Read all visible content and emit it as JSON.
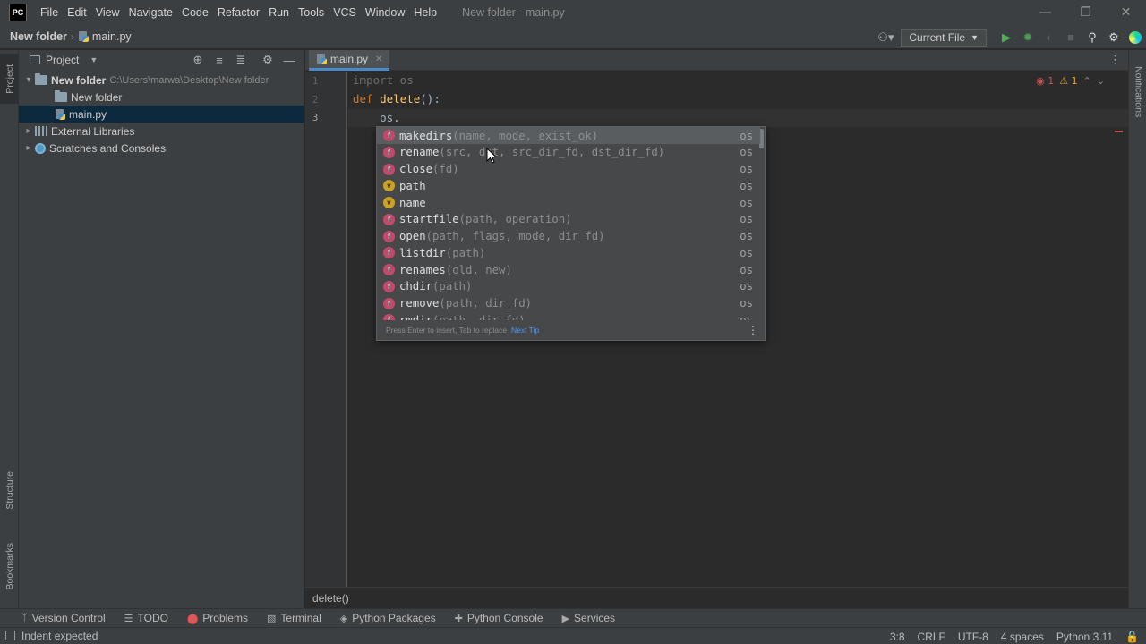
{
  "titlebar": {
    "logo": "PC",
    "menu": [
      "File",
      "Edit",
      "View",
      "Navigate",
      "Code",
      "Refactor",
      "Run",
      "Tools",
      "VCS",
      "Window",
      "Help"
    ],
    "window_title": "New folder - main.py"
  },
  "navbar": {
    "project": "New folder",
    "file": "main.py",
    "run_config": "Current File",
    "colors": {
      "run": "#4caf50",
      "debug": "#499c54"
    }
  },
  "left_stripe": {
    "project": "Project",
    "structure": "Structure",
    "bookmarks": "Bookmarks"
  },
  "project_panel": {
    "title": "Project",
    "tree": {
      "root": "New folder",
      "root_path": "C:\\Users\\marwa\\Desktop\\New folder",
      "child_folder": "New folder",
      "child_file": "main.py",
      "external": "External Libraries",
      "scratches": "Scratches and Consoles"
    }
  },
  "editor": {
    "tab": "main.py",
    "line_numbers": [
      "1",
      "2",
      "3"
    ],
    "lines": {
      "l1_kw": "import",
      "l1_mod": " os",
      "l2_kw": "def",
      "l2_fn": " delete",
      "l2_rest": "():",
      "l3": "    os."
    },
    "errors": "1",
    "warnings": "1",
    "breadcrumb": "delete()"
  },
  "completion": {
    "items": [
      {
        "kind": "f",
        "name": "makedirs",
        "params": "(name, mode, exist_ok)",
        "type": "os"
      },
      {
        "kind": "f",
        "name": "rename",
        "params": "(src, dst, src_dir_fd, dst_dir_fd)",
        "type": "os"
      },
      {
        "kind": "f",
        "name": "close",
        "params": "(fd)",
        "type": "os"
      },
      {
        "kind": "v",
        "name": "path",
        "params": "",
        "type": "os"
      },
      {
        "kind": "v",
        "name": "name",
        "params": "",
        "type": "os"
      },
      {
        "kind": "f",
        "name": "startfile",
        "params": "(path, operation)",
        "type": "os"
      },
      {
        "kind": "f",
        "name": "open",
        "params": "(path, flags, mode, dir_fd)",
        "type": "os"
      },
      {
        "kind": "f",
        "name": "listdir",
        "params": "(path)",
        "type": "os"
      },
      {
        "kind": "f",
        "name": "renames",
        "params": "(old, new)",
        "type": "os"
      },
      {
        "kind": "f",
        "name": "chdir",
        "params": "(path)",
        "type": "os"
      },
      {
        "kind": "f",
        "name": "remove",
        "params": "(path, dir_fd)",
        "type": "os"
      },
      {
        "kind": "f",
        "name": "rmdir",
        "params": "(path, dir_fd)",
        "type": "os"
      }
    ],
    "footer": "Press Enter to insert, Tab to replace",
    "next_tip": "Next Tip"
  },
  "right_stripe": {
    "notifications": "Notifications"
  },
  "tool_windows": [
    "Version Control",
    "TODO",
    "Problems",
    "Terminal",
    "Python Packages",
    "Python Console",
    "Services"
  ],
  "status": {
    "message": "Indent expected",
    "position": "3:8",
    "line_sep": "CRLF",
    "encoding": "UTF-8",
    "indent": "4 spaces",
    "interpreter": "Python 3.11"
  }
}
